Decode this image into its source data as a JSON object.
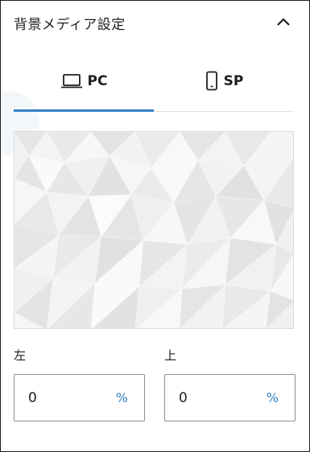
{
  "panel": {
    "title": "背景メディア設定",
    "collapse_icon": "chevron-up-icon"
  },
  "tabs": [
    {
      "label": "PC",
      "icon": "laptop-icon",
      "active": true
    },
    {
      "label": "SP",
      "icon": "smartphone-icon",
      "active": false
    }
  ],
  "colors": {
    "accent": "#3582c4",
    "border": "#8c8f94",
    "text": "#1e1e1e"
  },
  "media": {
    "pattern": "low-poly-white-geometric"
  },
  "position": {
    "left": {
      "label": "左",
      "value": "0",
      "unit": "%"
    },
    "top": {
      "label": "上",
      "value": "0",
      "unit": "%"
    }
  }
}
